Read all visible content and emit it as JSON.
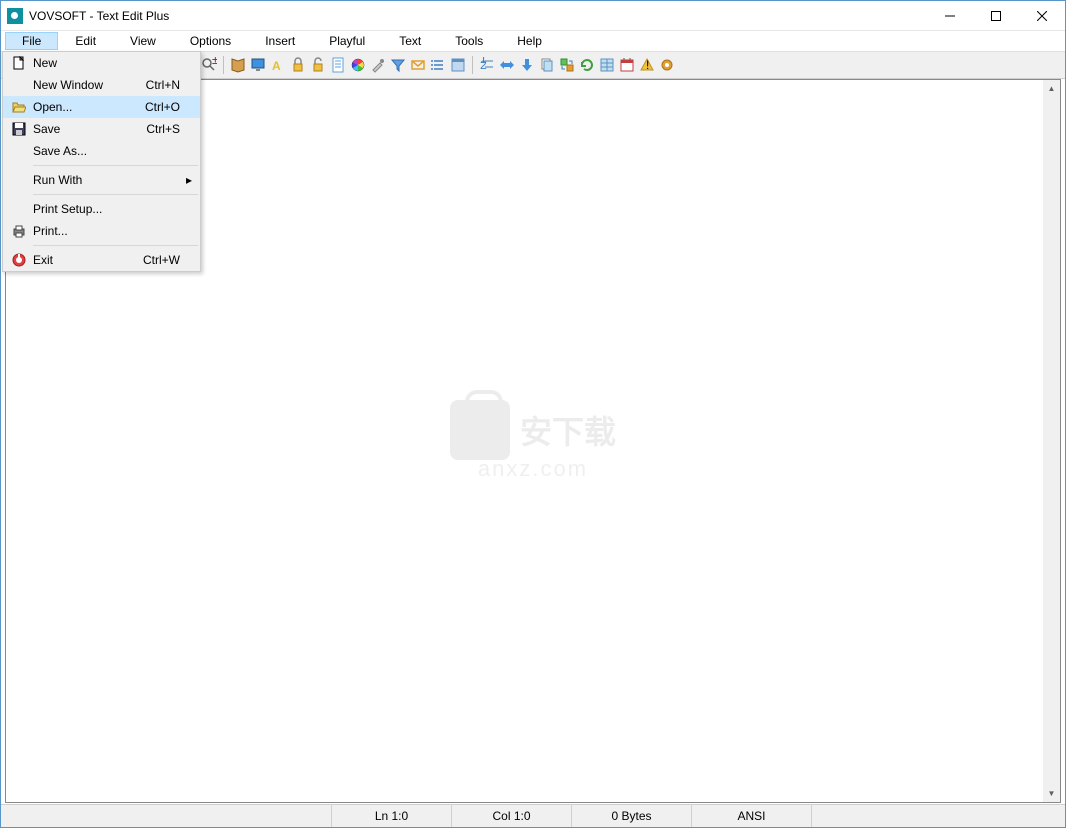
{
  "window": {
    "title": "VOVSOFT - Text Edit Plus"
  },
  "menubar": {
    "items": [
      "File",
      "Edit",
      "View",
      "Options",
      "Insert",
      "Playful",
      "Text",
      "Tools",
      "Help"
    ],
    "active_index": 0
  },
  "dropdown": {
    "items": [
      {
        "label": "New",
        "shortcut": "",
        "icon": "new-file-icon"
      },
      {
        "label": "New Window",
        "shortcut": "Ctrl+N",
        "icon": ""
      },
      {
        "label": "Open...",
        "shortcut": "Ctrl+O",
        "icon": "open-folder-icon",
        "hover": true
      },
      {
        "label": "Save",
        "shortcut": "Ctrl+S",
        "icon": "save-icon"
      },
      {
        "label": "Save As...",
        "shortcut": "",
        "icon": ""
      },
      {
        "type": "divider"
      },
      {
        "label": "Run With",
        "shortcut": "",
        "icon": "",
        "submenu": true
      },
      {
        "type": "divider"
      },
      {
        "label": "Print Setup...",
        "shortcut": "",
        "icon": ""
      },
      {
        "label": "Print...",
        "shortcut": "",
        "icon": "printer-icon"
      },
      {
        "type": "divider"
      },
      {
        "label": "Exit",
        "shortcut": "Ctrl+W",
        "icon": "exit-icon"
      }
    ]
  },
  "statusbar": {
    "line": "Ln 1:0",
    "col": "Col 1:0",
    "size": "0 Bytes",
    "encoding": "ANSI"
  },
  "watermark": {
    "cn": "安下载",
    "en": "anxz.com"
  }
}
